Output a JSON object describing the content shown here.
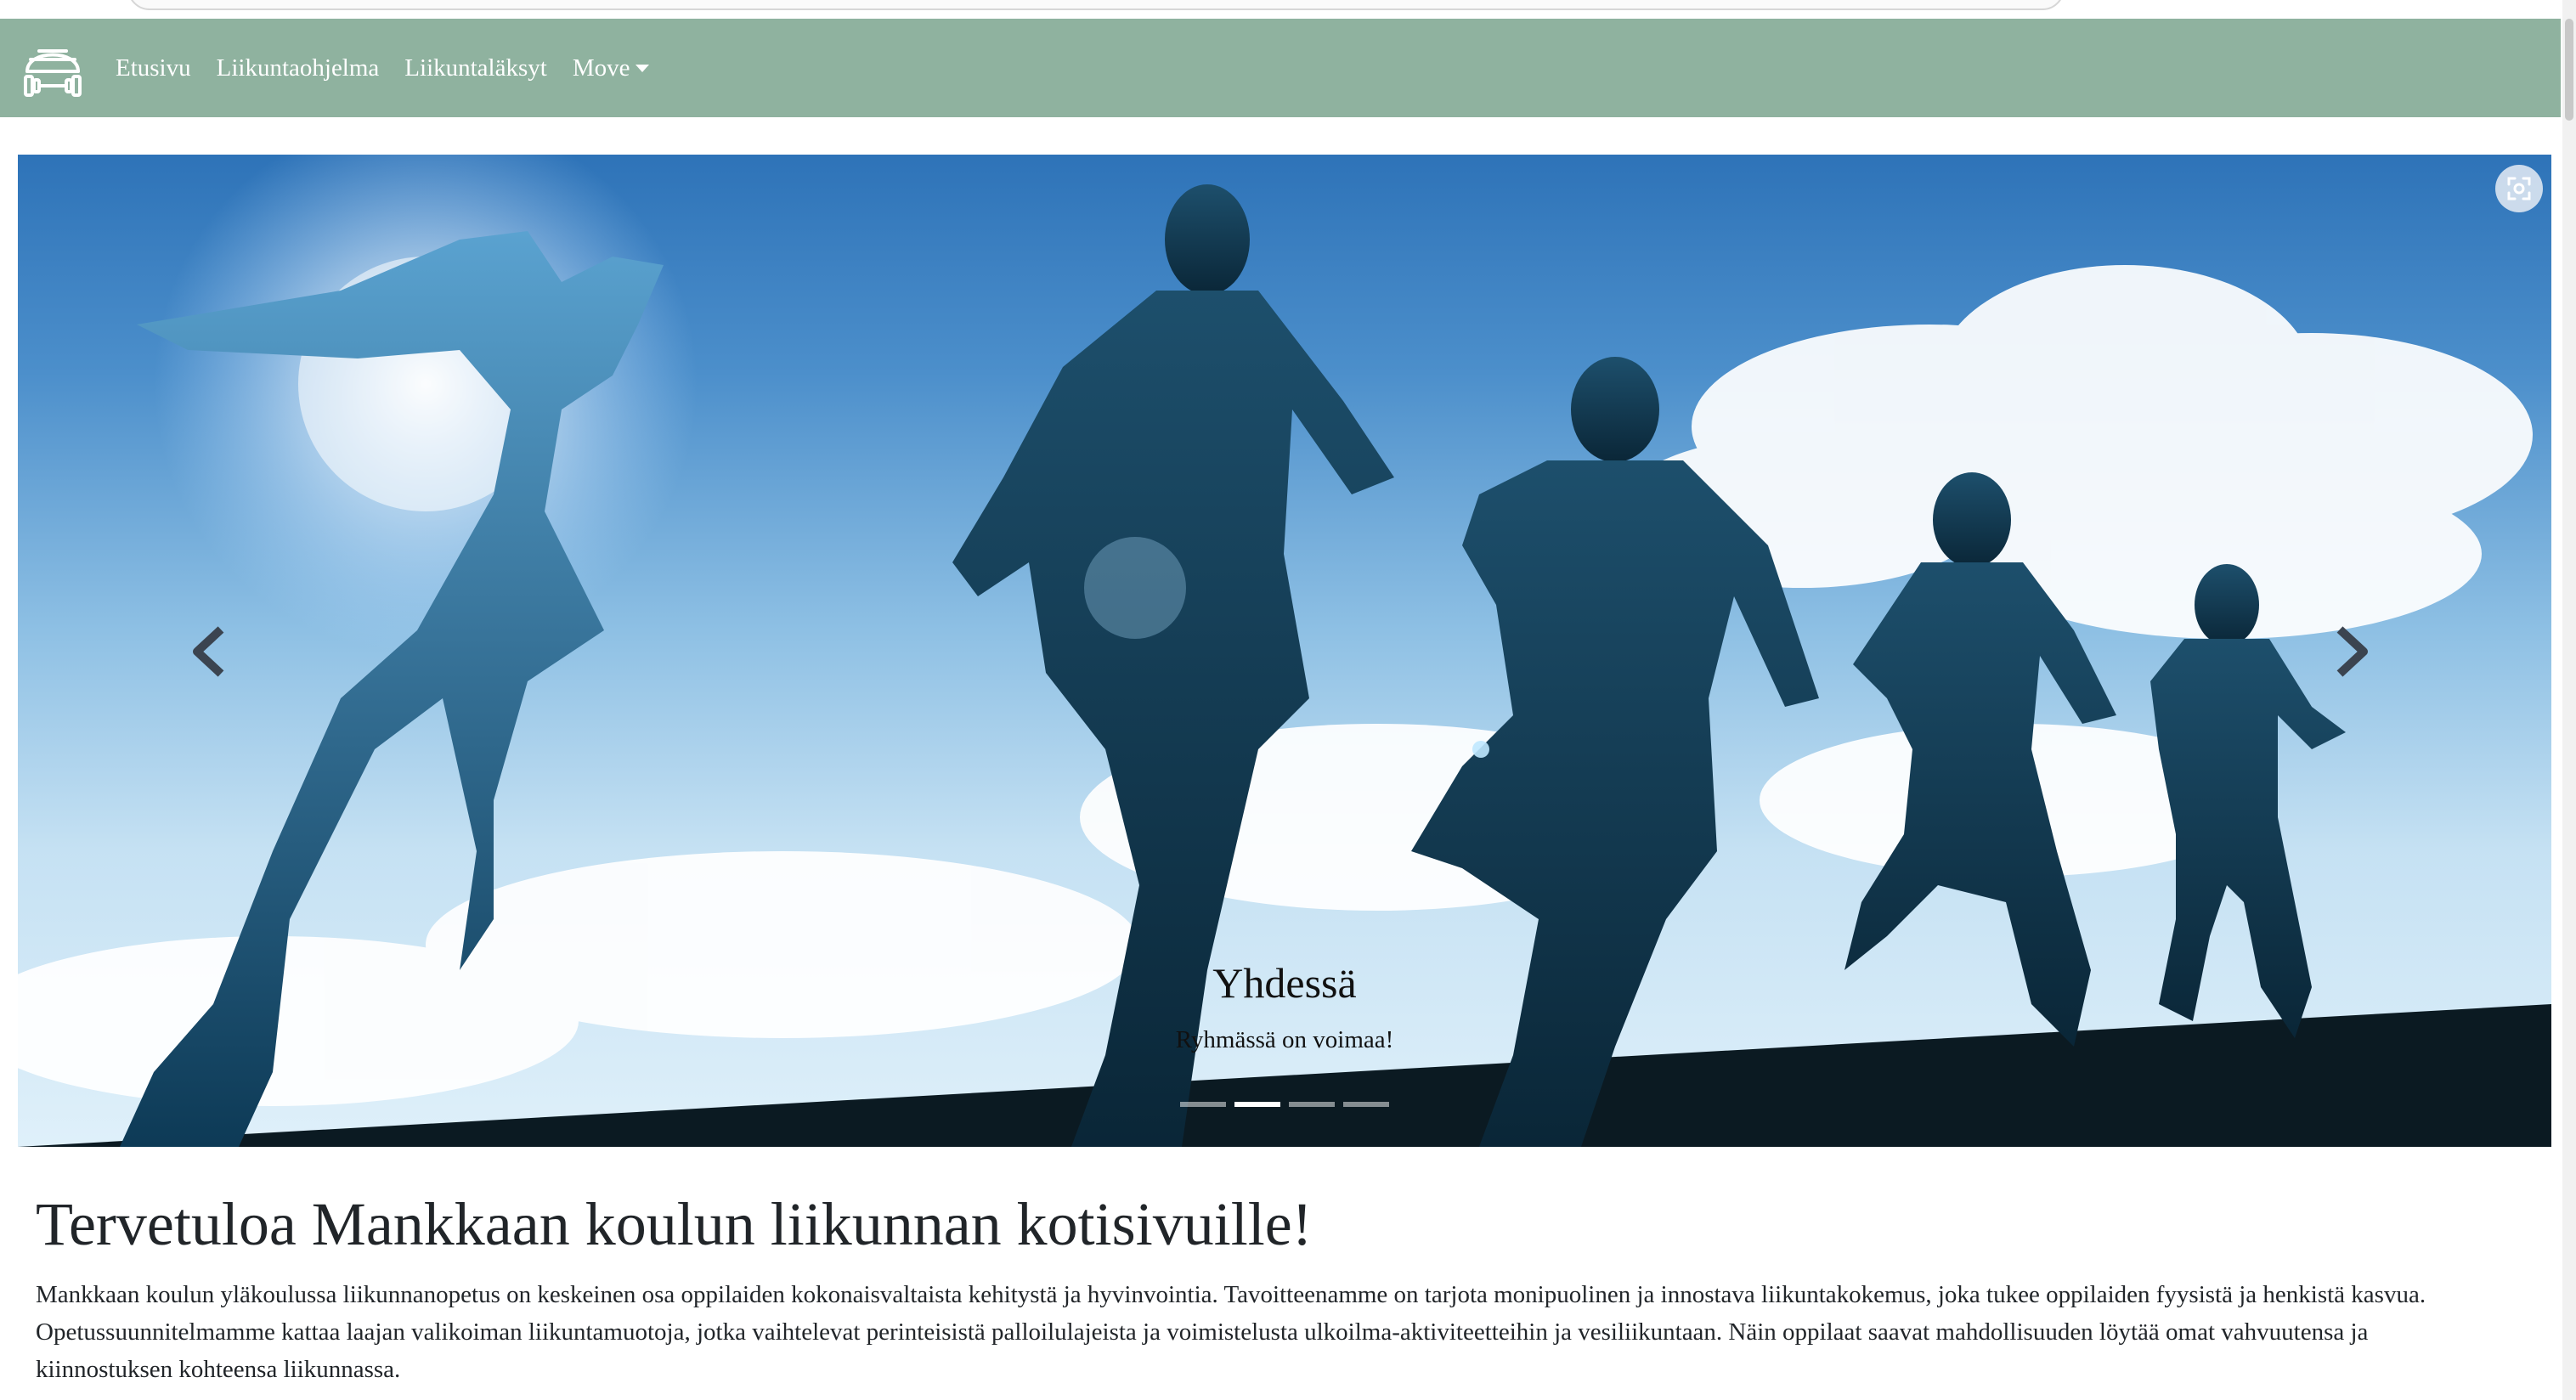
{
  "nav": {
    "brand_icon": "helmet-dumbbell-logo",
    "links": [
      "Etusivu",
      "Liikuntaohjelma",
      "Liikuntaläksyt"
    ],
    "dropdown_label": "Move"
  },
  "carousel": {
    "caption_title": "Yhdessä",
    "caption_text": "Ryhmässä on voimaa!",
    "slide_count": 4,
    "active_slide_index": 1,
    "prev_icon": "chevron-left-icon",
    "next_icon": "chevron-right-icon",
    "lens_icon": "visual-search-icon"
  },
  "content": {
    "heading": "Tervetuloa Mankkaan koulun liikunnan kotisivuille!",
    "paragraph": "Mankkaan koulun yläkoulussa liikunnanopetus on keskeinen osa oppilaiden kokonaisvaltaista kehitystä ja hyvinvointia. Tavoitteenamme on tarjota monipuolinen ja innostava liikuntakokemus, joka tukee oppilaiden fyysistä ja henkistä kasvua. Opetussuunnitelmamme kattaa laajan valikoiman liikuntamuotoja, jotka vaihtelevat perinteisistä palloilulajeista ja voimistelusta ulkoilma-aktiviteetteihin ja vesiliikuntaan. Näin oppilaat saavat mahdollisuuden löytää omat vahvuutensa ja kiinnostuksen kohteensa liikunnassa."
  },
  "colors": {
    "navbar": "#8fb29f",
    "nav_text": "#ffffff",
    "body_text": "#212529"
  }
}
